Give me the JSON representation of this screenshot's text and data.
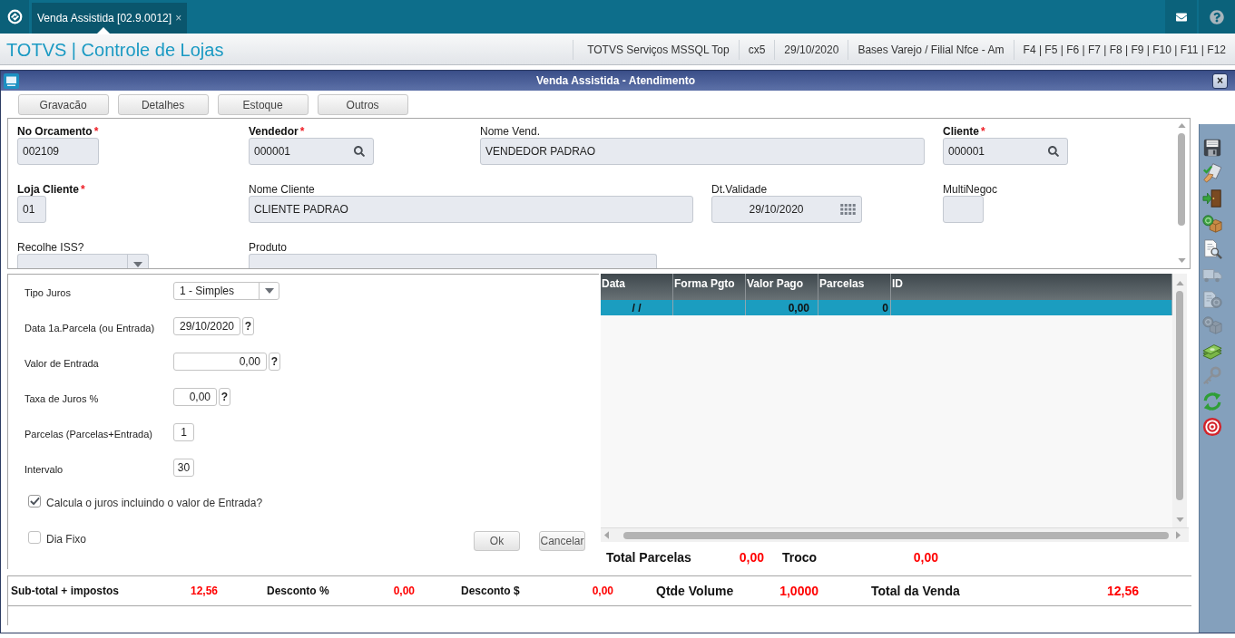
{
  "top_bar": {
    "tab": {
      "label": "Venda Assistida [02.9.0012]",
      "close": "×",
      "selected": true
    }
  },
  "header": {
    "title": "TOTVS | Controle de Lojas",
    "info": [
      "TOTVS Serviços MSSQL Top",
      "cx5",
      "29/10/2020",
      "Bases Varejo / Filial Nfce - Am",
      "F4 | F5 | F6 | F7 | F8 | F9 | F10 | F11 | F12"
    ]
  },
  "dialog": {
    "title": "Venda Assistida - Atendimento",
    "close": "×"
  },
  "action_buttons": [
    "Gravacão",
    "Detalhes",
    "Estoque",
    "Outros"
  ],
  "form": {
    "rows": [
      [
        {
          "label": "No Orcamento",
          "required_mark": "*",
          "kind": "text",
          "value": "002109"
        },
        {
          "label": "Vendedor",
          "required_mark": "*",
          "kind": "lookup",
          "value": "000001"
        },
        {
          "label": "Nome Vend.",
          "kind": "text",
          "value": "VENDEDOR PADRAO"
        },
        {
          "label": "Cliente",
          "required_mark": "*",
          "kind": "lookup",
          "value": "000001"
        }
      ],
      [
        {
          "label": "Loja Cliente",
          "required_mark": "*",
          "kind": "text",
          "value": "01"
        },
        {
          "label": "Nome Cliente",
          "kind": "text",
          "value": "CLIENTE PADRAO"
        },
        {
          "label": "Dt.Validade",
          "kind": "date",
          "value": "29/10/2020"
        },
        {
          "label": "MultiNegoc",
          "kind": "text"
        }
      ],
      [
        {
          "label": "Recolhe ISS?",
          "kind": "combo"
        },
        {
          "label": "Produto",
          "kind": "text"
        }
      ]
    ]
  },
  "installments": {
    "fields": [
      {
        "label": "Tipo Juros",
        "kind": "combo",
        "value": "1 - Simples"
      },
      {
        "label": "Data 1a.Parcela (ou Entrada)",
        "kind": "text",
        "value": "29/10/2020",
        "help": "?"
      },
      {
        "label": "Valor de Entrada",
        "kind": "text",
        "value": "0,00",
        "help": "?"
      },
      {
        "label": "Taxa de Juros %",
        "kind": "text",
        "value": "0,00",
        "help": "?"
      },
      {
        "label": "Parcelas (Parcelas+Entrada)",
        "kind": "text",
        "value": "1"
      },
      {
        "label": "Intervalo",
        "kind": "text",
        "value": "30"
      }
    ],
    "options": [
      {
        "label": "Calcula o juros incluindo o valor de Entrada?",
        "checked": true
      },
      {
        "label": "Dia Fixo",
        "checked": false
      }
    ],
    "buttons": [
      "Ok",
      "Cancelar"
    ]
  },
  "payments": {
    "columns": [
      "Data",
      "Forma Pgto",
      "Valor Pago",
      "Parcelas",
      "ID"
    ],
    "rows": [
      {
        "cells": [
          "/ /",
          null,
          "0,00",
          "0",
          null
        ],
        "selected": true
      }
    ]
  },
  "payment_totals": [
    {
      "label": "Total Parcelas",
      "value": "0,00"
    },
    {
      "label": "Troco",
      "value": "0,00"
    }
  ],
  "summary": {
    "minor": [
      {
        "label": "Sub-total + impostos",
        "value": "12,56"
      },
      {
        "label": "Desconto %",
        "value": "0,00"
      },
      {
        "label": "Desconto $",
        "value": "0,00"
      }
    ],
    "major": [
      {
        "label": "Qtde Volume",
        "value": "1,0000"
      },
      {
        "label": "Total da Venda",
        "value": "12,56"
      }
    ]
  },
  "side_toolbar": [
    {
      "disabled": false
    },
    {
      "disabled": false
    },
    {
      "disabled": false
    },
    {
      "disabled": false
    },
    {
      "disabled": false
    },
    {
      "disabled": true
    },
    {
      "disabled": true
    },
    {
      "disabled": true
    },
    {
      "disabled": false
    },
    {
      "disabled": false
    },
    {
      "disabled": false
    },
    {
      "disabled": false
    }
  ]
}
